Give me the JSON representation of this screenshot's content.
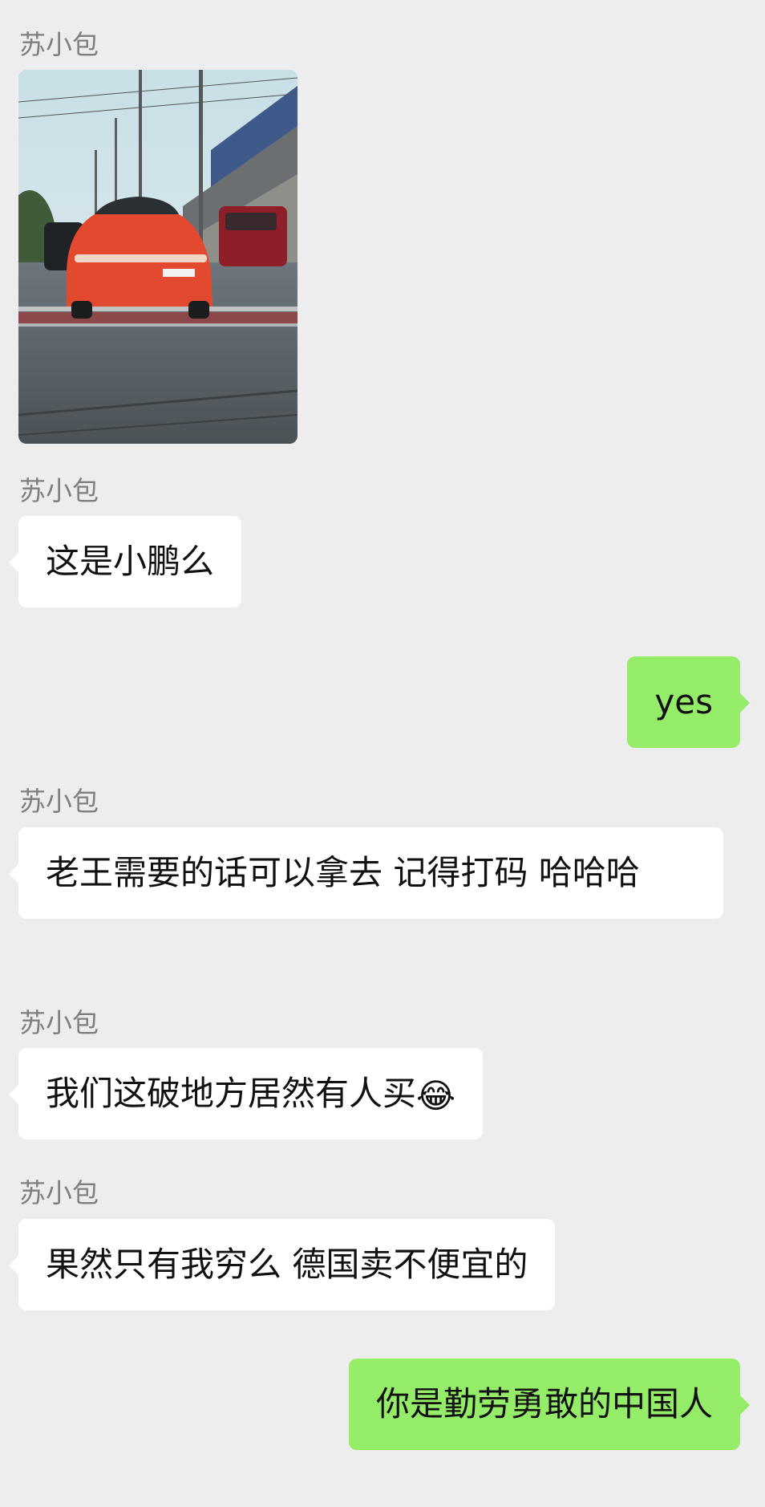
{
  "messages": [
    {
      "sender": "苏小包",
      "type": "image"
    },
    {
      "sender": "苏小包",
      "type": "text",
      "text": "这是小鹏么"
    },
    {
      "side": "right",
      "type": "text",
      "text": "yes"
    },
    {
      "sender": "苏小包",
      "type": "text",
      "text": "老王需要的话可以拿去 记得打码 哈哈哈"
    },
    {
      "sender": "苏小包",
      "type": "text",
      "text": "我们这破地方居然有人买",
      "emoji": "😂"
    },
    {
      "sender": "苏小包",
      "type": "text",
      "text": "果然只有我穷么 德国卖不便宜的"
    },
    {
      "side": "right",
      "type": "text",
      "text": "你是勤劳勇敢的中国人"
    }
  ]
}
